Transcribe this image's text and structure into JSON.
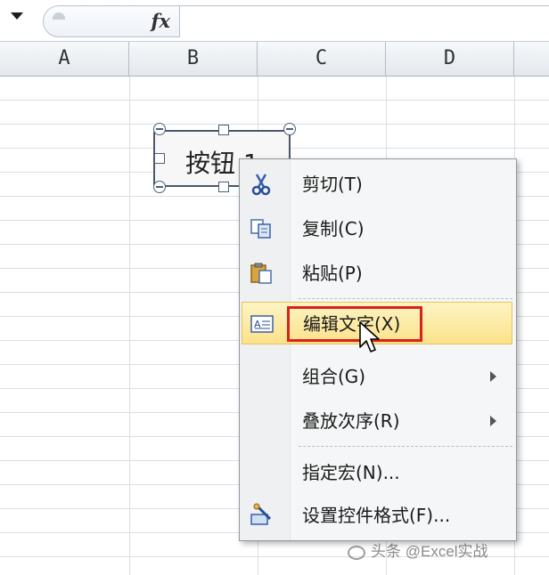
{
  "formula_bar": {
    "name_dropdown_icon": "chevron-down-icon",
    "fx_label": "fx",
    "formula_value": ""
  },
  "columns": [
    "A",
    "B",
    "C",
    "D"
  ],
  "form_button": {
    "label": "按钮 1"
  },
  "context_menu": {
    "items": [
      {
        "label": "剪切(T)",
        "icon": "scissors-icon"
      },
      {
        "label": "复制(C)",
        "icon": "copy-icon"
      },
      {
        "label": "粘贴(P)",
        "icon": "paste-icon"
      },
      {
        "label": "编辑文字(X)",
        "icon": "edit-text-icon",
        "highlighted": true
      },
      {
        "label": "组合(G)",
        "submenu": true
      },
      {
        "label": "叠放次序(R)",
        "submenu": true
      },
      {
        "label": "指定宏(N)..."
      },
      {
        "label": "设置控件格式(F)...",
        "icon": "format-control-icon"
      }
    ]
  },
  "watermark": "头条 @Excel实战",
  "colors": {
    "highlight": "#fbe28a",
    "red_annotation": "#d9221c",
    "menu_bg": "#f5f6f7"
  }
}
